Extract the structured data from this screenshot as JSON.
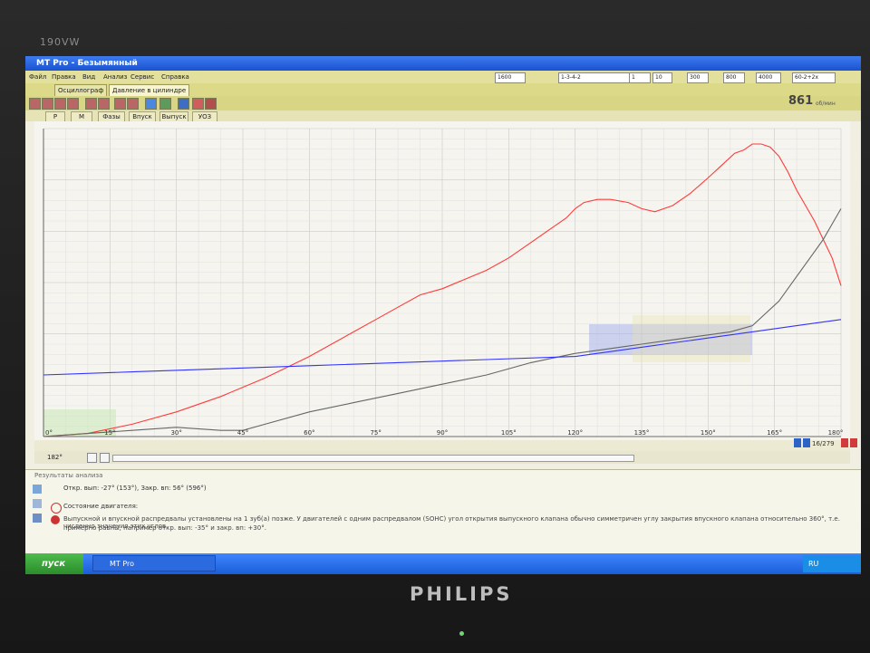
{
  "monitor": {
    "model": "190VW",
    "brand": "PHILIPS"
  },
  "window": {
    "title": "MT Pro - Безымянный"
  },
  "menu": [
    "Файл",
    "Правка",
    "Вид",
    "Анализ",
    "Сервис",
    "Справка"
  ],
  "toolbar_controls": {
    "rpm_field": "1600",
    "firing_order": "1-3-4-2",
    "cyl": "1",
    "scale1": "10",
    "scale2": "300",
    "scale3": "800",
    "scale4": "4000",
    "mode": "60-2+2x"
  },
  "tabs": [
    "Осциллограф",
    "Давление в цилиндре"
  ],
  "rpm": {
    "value": "861",
    "unit": "об/мин"
  },
  "subtabs": [
    "P",
    "M",
    "Фазы",
    "Впуск",
    "Выпуск",
    "УОЗ"
  ],
  "chart_data": {
    "type": "line",
    "x_ticks": [
      "0°",
      "15°",
      "30°",
      "45°",
      "60°",
      "75°",
      "90°",
      "105°",
      "120°",
      "135°",
      "150°",
      "165°",
      "180°"
    ],
    "xlim": [
      0,
      180
    ],
    "ylim": [
      0,
      100
    ],
    "grid": true,
    "series": [
      {
        "color": "#ff3b3b",
        "x": [
          0,
          10,
          20,
          30,
          40,
          50,
          60,
          65,
          70,
          75,
          80,
          85,
          90,
          95,
          100,
          105,
          110,
          115,
          118,
          120,
          122,
          125,
          128,
          132,
          135,
          138,
          142,
          146,
          150,
          153,
          156,
          158,
          160,
          162,
          164,
          166,
          168,
          170,
          172,
          174,
          176,
          178,
          180
        ],
        "y": [
          0,
          1,
          4,
          8,
          13,
          19,
          26,
          30,
          34,
          38,
          42,
          46,
          48,
          51,
          54,
          58,
          63,
          68,
          71,
          74,
          76,
          77,
          77,
          76,
          74,
          73,
          75,
          79,
          84,
          88,
          92,
          93,
          95,
          95,
          94,
          91,
          86,
          80,
          75,
          70,
          64,
          58,
          49
        ]
      },
      {
        "color": "#666666",
        "x": [
          0,
          10,
          20,
          30,
          40,
          45,
          50,
          60,
          70,
          80,
          90,
          100,
          110,
          120,
          130,
          135,
          140,
          145,
          150,
          155,
          160,
          163,
          166,
          170,
          173,
          176,
          178,
          180
        ],
        "y": [
          0,
          1,
          2,
          3,
          2,
          2,
          4,
          8,
          11,
          14,
          17,
          20,
          24,
          27,
          29,
          30,
          31,
          32,
          33,
          34,
          36,
          40,
          44,
          52,
          58,
          64,
          69,
          74
        ]
      },
      {
        "color": "#3232ff",
        "x": [
          0,
          20,
          40,
          60,
          80,
          100,
          120,
          130,
          140,
          150,
          160,
          170,
          180
        ],
        "y": [
          20,
          21,
          22,
          23,
          24,
          25,
          26,
          28,
          30,
          32,
          34,
          36,
          38
        ]
      }
    ]
  },
  "nav": {
    "cursor_value": "182°",
    "position": "16/279"
  },
  "results": {
    "header": "Результаты анализа",
    "line1": "Откр. вып: -27° (153°), Закр. вп: 56° (596°)",
    "line2": "Состояние двигателя:",
    "line3": "Выпускной и впускной распредвалы установлены на 1 зуб(а) позже. У двигателей с одним распредвалом (SOHC) угол открытия выпускного клапана обычно симметричен углу закрытия впускного клапана относительно 360°, т.е. численно значения этих углов",
    "line4": "примерно равны, например откр. вып: -35° и закр. вп: +30°."
  },
  "taskbar": {
    "start": "пуск",
    "app": "MT Pro",
    "lang": "RU"
  }
}
